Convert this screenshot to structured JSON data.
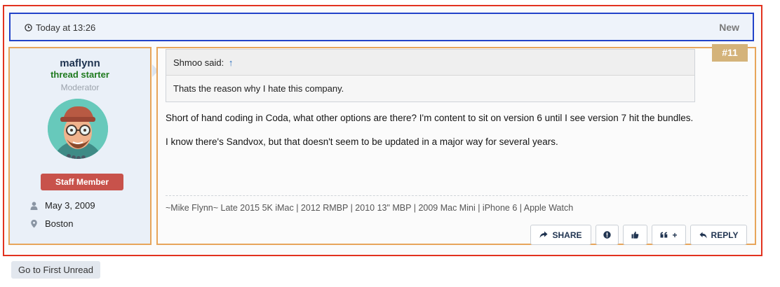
{
  "post": {
    "time": "Today at 13:26",
    "new_label": "New",
    "number": "#11"
  },
  "user": {
    "username": "maflynn",
    "thread_starter": "thread starter",
    "role": "Moderator",
    "badge": "Staff Member",
    "joined": "May 3, 2009",
    "location": "Boston"
  },
  "quote": {
    "author": "Shmoo said:",
    "arrow": "↑",
    "text": "Thats the reason why I hate this company."
  },
  "message": {
    "paragraph1": "Short of hand coding in Coda, what other options are there? I'm content to sit on version 6 until I see version 7 hit the bundles.",
    "paragraph2": "I know there's Sandvox, but that doesn't seem to be updated in a major way for several years."
  },
  "signature": "~Mike Flynn~ Late 2015 5K iMac | 2012 RMBP | 2010 13\" MBP | 2009 Mac Mini | iPhone 6 | Apple Watch",
  "actions": {
    "share": "SHARE",
    "quote_plus": "+",
    "reply": "REPLY"
  },
  "footer": {
    "first_unread": "Go to First Unread"
  },
  "colors": {
    "outer_border": "#e2321f",
    "header_border": "#2243c9",
    "panel_border": "#e7a55a",
    "badge": "#c8524b",
    "post_number": "#d4b37a",
    "thread_starter": "#1e7a1e"
  },
  "icons": {
    "time": "clock-icon",
    "joined": "user-icon",
    "location": "map-pin-icon",
    "share": "share-arrow-icon",
    "report": "exclamation-icon",
    "like": "thumbs-up-icon",
    "multiquote": "quote-icon",
    "reply": "reply-icon"
  }
}
